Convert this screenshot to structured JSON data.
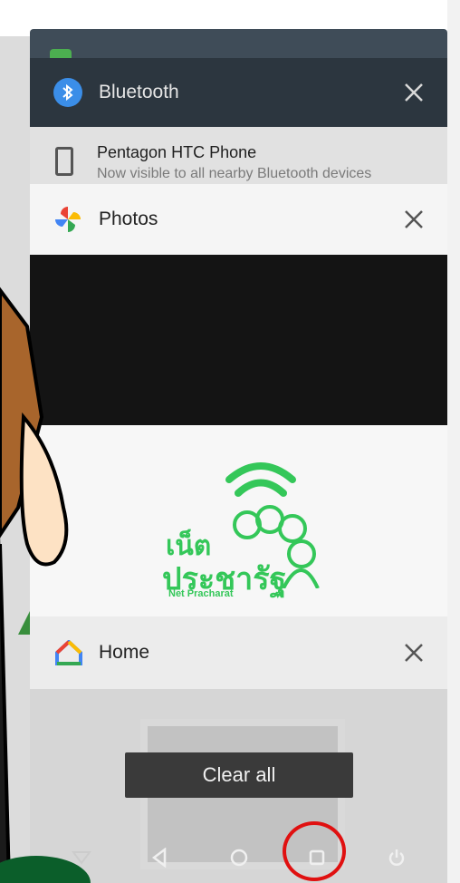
{
  "cards": {
    "bluetooth": {
      "title": "Bluetooth",
      "device_name": "Pentagon HTC Phone",
      "device_status": "Now visible to all nearby Bluetooth devices"
    },
    "photos": {
      "title": "Photos",
      "logo_thai_line1": "เน็ต",
      "logo_thai_line2": "ประชารัฐ",
      "logo_en": "Net Pracharat"
    },
    "home": {
      "title": "Home"
    }
  },
  "clear_all_label": "Clear all",
  "colors": {
    "bluetooth_header": "#2c363f",
    "bluetooth_accent": "#3b8ee8",
    "logo_green": "#34c759",
    "highlight_red": "#e01010"
  },
  "icons": {
    "bluetooth": "bluetooth-icon",
    "photos": "photos-pinwheel-icon",
    "home": "google-home-icon",
    "close": "close-icon",
    "nav_hide": "hide-keyboard-icon",
    "nav_back": "back-icon",
    "nav_home": "home-circle-icon",
    "nav_recents": "recents-square-icon",
    "nav_power": "power-icon"
  }
}
